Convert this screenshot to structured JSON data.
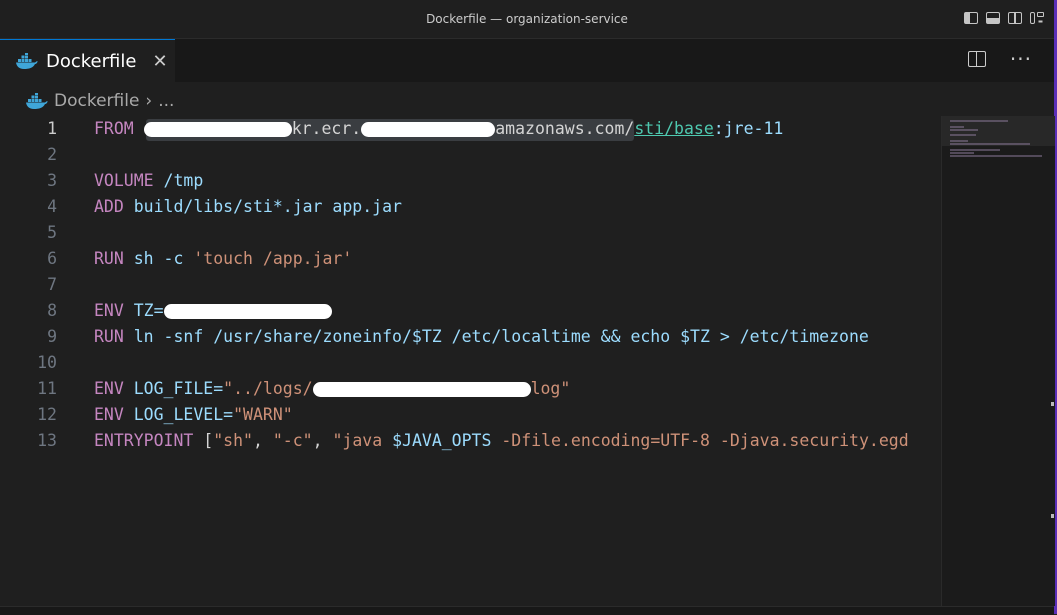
{
  "window": {
    "title": "Dockerfile — organization-service"
  },
  "tab": {
    "label": "Dockerfile",
    "close": "✕",
    "icon": "docker-icon"
  },
  "tab_actions": {
    "more": "···"
  },
  "breadcrumb": {
    "file": "Dockerfile",
    "separator": "›",
    "rest": "..."
  },
  "colors": {
    "keyword": "#c586c0",
    "argument": "#9cdcfe",
    "string": "#ce9178",
    "link": "#4ec9b0",
    "background": "#1f1f1f"
  },
  "editor": {
    "lines": [
      {
        "num": "1"
      },
      {
        "num": "2"
      },
      {
        "num": "3"
      },
      {
        "num": "4"
      },
      {
        "num": "5"
      },
      {
        "num": "6"
      },
      {
        "num": "7"
      },
      {
        "num": "8"
      },
      {
        "num": "9"
      },
      {
        "num": "10"
      },
      {
        "num": "11"
      },
      {
        "num": "12"
      },
      {
        "num": "13"
      }
    ],
    "l1": {
      "kw": "FROM",
      "a": "kr.ecr.",
      "b": "amazonaws.com/",
      "link1": "sti/base",
      "c": ":jre-11"
    },
    "l3": {
      "kw": "VOLUME",
      "arg": " /tmp"
    },
    "l4": {
      "kw": "ADD",
      "arg": " build/libs/sti*.jar app.jar"
    },
    "l6": {
      "kw": "RUN",
      "arg": " sh -c ",
      "str": "'touch /app.jar'"
    },
    "l8": {
      "kw": "ENV",
      "arg": " TZ="
    },
    "l9": {
      "kw": "RUN",
      "arg": " ln -snf /usr/share/zoneinfo/$TZ /etc/localtime && echo $TZ > /etc/timezone"
    },
    "l11": {
      "kw": "ENV",
      "arg": " LOG_FILE=",
      "str1": "\"../logs/",
      "str2": "log\""
    },
    "l12": {
      "kw": "ENV",
      "arg": " LOG_LEVEL=",
      "str": "\"WARN\""
    },
    "l13": {
      "kw": "ENTRYPOINT",
      "p1": " [",
      "s1": "\"sh\"",
      "c1": ", ",
      "s2": "\"-c\"",
      "c2": ", ",
      "s3": "\"java ",
      "v": "$JAVA_OPTS",
      "s4": " -Dfile.encoding=UTF-8 -Djava.security.egd"
    }
  }
}
